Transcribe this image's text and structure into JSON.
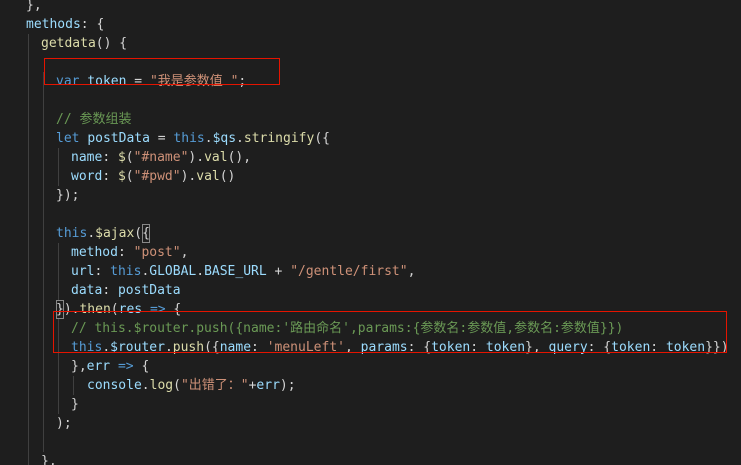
{
  "colors": {
    "background": "#1e1e1e",
    "default": "#d4d4d4",
    "keyword": "#569cd6",
    "function": "#dcdcaa",
    "property": "#9cdcfe",
    "string": "#ce9178",
    "comment": "#6a9955",
    "highlight_border": "#e51400"
  },
  "lines": [
    {
      "indent": 1,
      "tokens": [
        {
          "t": "},",
          "c": "default"
        }
      ]
    },
    {
      "indent": 1,
      "tokens": [
        {
          "t": "methods",
          "c": "property"
        },
        {
          "t": ": {",
          "c": "default"
        }
      ]
    },
    {
      "indent": 2,
      "tokens": [
        {
          "t": "getdata",
          "c": "function"
        },
        {
          "t": "() {",
          "c": "default"
        }
      ]
    },
    {
      "indent": 0,
      "tokens": []
    },
    {
      "indent": 3,
      "tokens": [
        {
          "t": "var",
          "c": "keyword"
        },
        {
          "t": " ",
          "c": "default"
        },
        {
          "t": "token",
          "c": "property"
        },
        {
          "t": " = ",
          "c": "default"
        },
        {
          "t": "\"我是参数值 \"",
          "c": "string"
        },
        {
          "t": ";",
          "c": "default"
        }
      ]
    },
    {
      "indent": 0,
      "tokens": []
    },
    {
      "indent": 3,
      "tokens": [
        {
          "t": "// 参数组装",
          "c": "comment"
        }
      ]
    },
    {
      "indent": 3,
      "tokens": [
        {
          "t": "let",
          "c": "keyword"
        },
        {
          "t": " ",
          "c": "default"
        },
        {
          "t": "postData",
          "c": "property"
        },
        {
          "t": " = ",
          "c": "default"
        },
        {
          "t": "this",
          "c": "keyword"
        },
        {
          "t": ".",
          "c": "default"
        },
        {
          "t": "$qs",
          "c": "property"
        },
        {
          "t": ".",
          "c": "default"
        },
        {
          "t": "stringify",
          "c": "function"
        },
        {
          "t": "({",
          "c": "default"
        }
      ]
    },
    {
      "indent": 4,
      "tokens": [
        {
          "t": "name",
          "c": "property"
        },
        {
          "t": ": ",
          "c": "default"
        },
        {
          "t": "$",
          "c": "function"
        },
        {
          "t": "(",
          "c": "default"
        },
        {
          "t": "\"#name\"",
          "c": "string"
        },
        {
          "t": ").",
          "c": "default"
        },
        {
          "t": "val",
          "c": "function"
        },
        {
          "t": "(),",
          "c": "default"
        }
      ]
    },
    {
      "indent": 4,
      "tokens": [
        {
          "t": "word",
          "c": "property"
        },
        {
          "t": ": ",
          "c": "default"
        },
        {
          "t": "$",
          "c": "function"
        },
        {
          "t": "(",
          "c": "default"
        },
        {
          "t": "\"#pwd\"",
          "c": "string"
        },
        {
          "t": ").",
          "c": "default"
        },
        {
          "t": "val",
          "c": "function"
        },
        {
          "t": "()",
          "c": "default"
        }
      ]
    },
    {
      "indent": 3,
      "tokens": [
        {
          "t": "});",
          "c": "default"
        }
      ]
    },
    {
      "indent": 0,
      "tokens": []
    },
    {
      "indent": 3,
      "tokens": [
        {
          "t": "this",
          "c": "keyword"
        },
        {
          "t": ".",
          "c": "default"
        },
        {
          "t": "$ajax",
          "c": "function"
        },
        {
          "t": "(",
          "c": "default"
        },
        {
          "t": "{",
          "c": "default",
          "box": true
        }
      ]
    },
    {
      "indent": 4,
      "tokens": [
        {
          "t": "method",
          "c": "property"
        },
        {
          "t": ": ",
          "c": "default"
        },
        {
          "t": "\"post\"",
          "c": "string"
        },
        {
          "t": ",",
          "c": "default"
        }
      ]
    },
    {
      "indent": 4,
      "tokens": [
        {
          "t": "url",
          "c": "property"
        },
        {
          "t": ": ",
          "c": "default"
        },
        {
          "t": "this",
          "c": "keyword"
        },
        {
          "t": ".",
          "c": "default"
        },
        {
          "t": "GLOBAL",
          "c": "property"
        },
        {
          "t": ".",
          "c": "default"
        },
        {
          "t": "BASE_URL",
          "c": "property"
        },
        {
          "t": " + ",
          "c": "default"
        },
        {
          "t": "\"/gentle/first\"",
          "c": "string"
        },
        {
          "t": ",",
          "c": "default"
        }
      ]
    },
    {
      "indent": 4,
      "tokens": [
        {
          "t": "data",
          "c": "property"
        },
        {
          "t": ": ",
          "c": "default"
        },
        {
          "t": "postData",
          "c": "property"
        }
      ]
    },
    {
      "indent": 3,
      "tokens": [
        {
          "t": "}",
          "c": "default",
          "box": true
        },
        {
          "t": ").",
          "c": "default"
        },
        {
          "t": "then",
          "c": "function"
        },
        {
          "t": "(",
          "c": "default"
        },
        {
          "t": "res",
          "c": "property"
        },
        {
          "t": " ",
          "c": "default"
        },
        {
          "t": "=>",
          "c": "keyword"
        },
        {
          "t": " {",
          "c": "default"
        }
      ]
    },
    {
      "indent": 4,
      "tokens": [
        {
          "t": "// this.$router.push({name:'路由命名',params:{参数名:参数值,参数名:参数值}})",
          "c": "comment"
        }
      ]
    },
    {
      "indent": 4,
      "tokens": [
        {
          "t": "this",
          "c": "keyword"
        },
        {
          "t": ".",
          "c": "default"
        },
        {
          "t": "$router",
          "c": "property"
        },
        {
          "t": ".",
          "c": "default"
        },
        {
          "t": "push",
          "c": "function"
        },
        {
          "t": "({",
          "c": "default"
        },
        {
          "t": "name",
          "c": "property"
        },
        {
          "t": ": ",
          "c": "default"
        },
        {
          "t": "'menuLeft'",
          "c": "string"
        },
        {
          "t": ", ",
          "c": "default"
        },
        {
          "t": "params",
          "c": "property"
        },
        {
          "t": ": {",
          "c": "default"
        },
        {
          "t": "token",
          "c": "property"
        },
        {
          "t": ": ",
          "c": "default"
        },
        {
          "t": "token",
          "c": "property"
        },
        {
          "t": "}, ",
          "c": "default"
        },
        {
          "t": "query",
          "c": "property"
        },
        {
          "t": ": {",
          "c": "default"
        },
        {
          "t": "token",
          "c": "property"
        },
        {
          "t": ": ",
          "c": "default"
        },
        {
          "t": "token",
          "c": "property"
        },
        {
          "t": "}})",
          "c": "default"
        }
      ]
    },
    {
      "indent": 4,
      "tokens": [
        {
          "t": "},",
          "c": "default"
        },
        {
          "t": "err",
          "c": "property"
        },
        {
          "t": " ",
          "c": "default"
        },
        {
          "t": "=>",
          "c": "keyword"
        },
        {
          "t": " {",
          "c": "default"
        }
      ]
    },
    {
      "indent": 5,
      "tokens": [
        {
          "t": "console",
          "c": "property"
        },
        {
          "t": ".",
          "c": "default"
        },
        {
          "t": "log",
          "c": "function"
        },
        {
          "t": "(",
          "c": "default"
        },
        {
          "t": "\"出错了：\"",
          "c": "string"
        },
        {
          "t": "+",
          "c": "default"
        },
        {
          "t": "err",
          "c": "property"
        },
        {
          "t": ");",
          "c": "default"
        }
      ]
    },
    {
      "indent": 4,
      "tokens": [
        {
          "t": "}",
          "c": "default"
        }
      ]
    },
    {
      "indent": 3,
      "tokens": [
        {
          "t": ");",
          "c": "default"
        }
      ]
    },
    {
      "indent": 0,
      "tokens": []
    },
    {
      "indent": 2,
      "tokens": [
        {
          "t": "},",
          "c": "default"
        }
      ]
    }
  ]
}
